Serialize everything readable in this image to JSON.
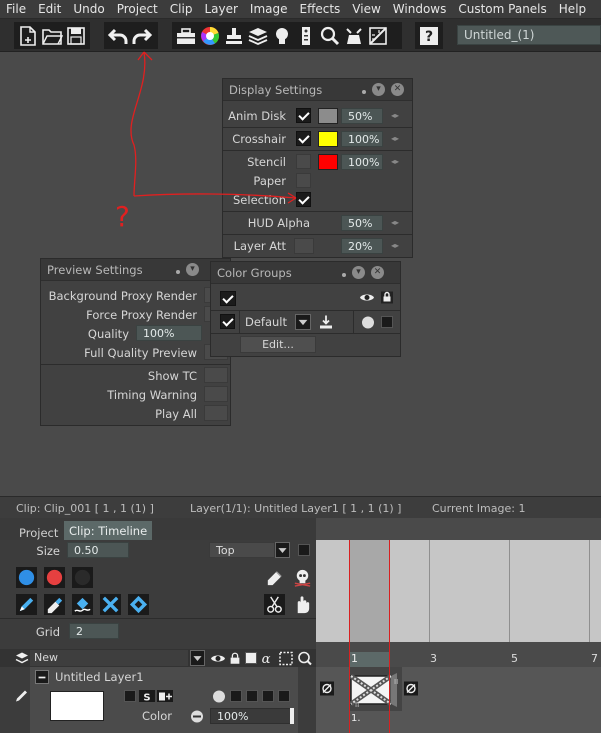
{
  "menu": [
    "File",
    "Edit",
    "Undo",
    "Project",
    "Clip",
    "Layer",
    "Image",
    "Effects",
    "View",
    "Windows",
    "Custom Panels",
    "Help"
  ],
  "toolbar": {
    "project_name": "Untitled_(1)",
    "icons": [
      "new-file-icon",
      "open-folder-icon",
      "save-icon",
      "undo-icon",
      "redo-icon",
      "toolbox-icon",
      "color-wheel-icon",
      "stamp-icon",
      "layers-icon",
      "lightbulb-icon",
      "remote-icon",
      "magnifier-icon",
      "brush-cleanup-icon",
      "ruler-icon",
      "help-icon"
    ]
  },
  "display_settings": {
    "title": "Display Settings",
    "rows": [
      {
        "label": "Anim Disk",
        "checked": true,
        "swatch": "#8c8c8c",
        "value": "50%"
      },
      {
        "label": "Crosshair",
        "checked": true,
        "swatch": "#ffff00",
        "value": "100%"
      },
      {
        "label": "Stencil",
        "checked": false,
        "swatch": "#ff0000",
        "value": "100%"
      },
      {
        "label": "Paper",
        "checked": false
      },
      {
        "label": "Selection",
        "checked": true
      }
    ],
    "hud_alpha": {
      "label": "HUD Alpha",
      "value": "50%"
    },
    "layer_att": {
      "label": "Layer Att",
      "value": "20%"
    }
  },
  "preview_settings": {
    "title": "Preview Settings",
    "rows": [
      "Background Proxy Render",
      "Force Proxy Render"
    ],
    "quality": {
      "label": "Quality",
      "value": "100%"
    },
    "full_quality": "Full Quality Preview",
    "rows2": [
      "Show TC",
      "Timing Warning",
      "Play All"
    ]
  },
  "color_groups": {
    "title": "Color Groups",
    "default_label": "Default",
    "edit_label": "Edit..."
  },
  "info": {
    "clip": "Clip: Clip_001 [ 1 , 1  (1) ]",
    "layer": "Layer(1/1): Untitled Layer1 [ 1 , 1  (1) ]",
    "image": "Current Image: 1"
  },
  "tabs": {
    "project": "Project",
    "timeline": "Clip: Timeline"
  },
  "left": {
    "size_label": "Size",
    "size_value": "0.50",
    "position_value": "Top",
    "grid_label": "Grid",
    "grid_value": "2",
    "new_label": "New",
    "layer_name": "Untitled Layer1",
    "color_label": "Color",
    "color_value": "100%"
  },
  "ruler": [
    "1",
    "3",
    "5",
    "7"
  ],
  "frame_label": "1.",
  "annotation": {
    "question": "?"
  },
  "colors": {
    "accent": "#5c6968",
    "annotation": "#e02020",
    "playhead": "#d82020"
  }
}
